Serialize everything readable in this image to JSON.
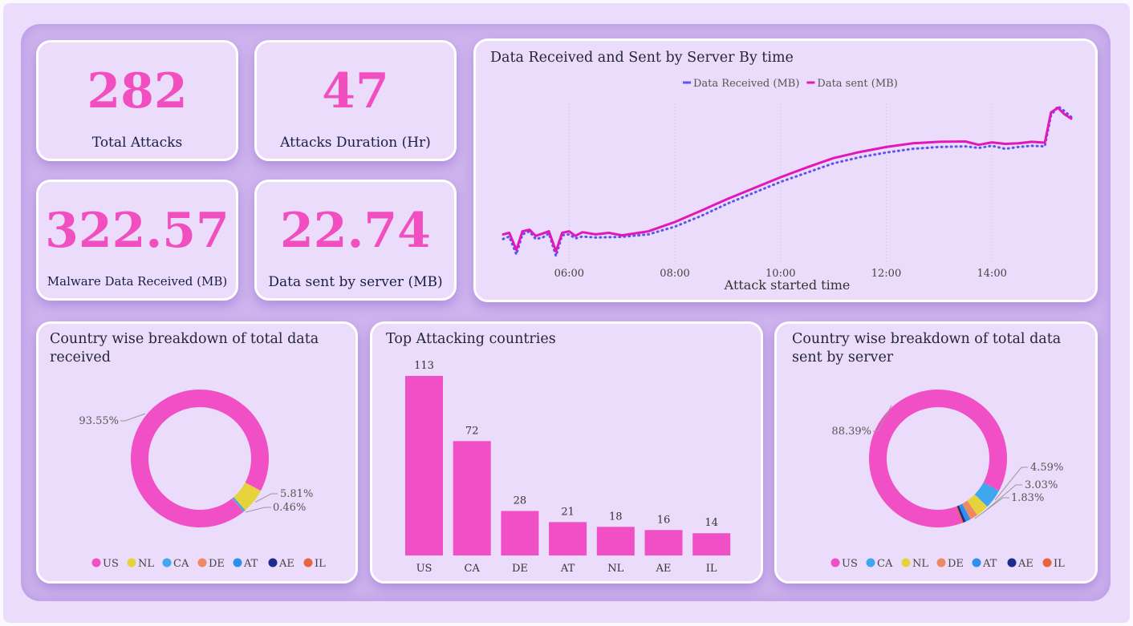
{
  "kpis": {
    "total_attacks": {
      "value": "282",
      "label": "Total Attacks"
    },
    "attacks_duration": {
      "value": "47",
      "label": "Attacks Duration (Hr)"
    },
    "malware_received": {
      "value": "322.57",
      "label": "Malware Data Received (MB)"
    },
    "data_sent": {
      "value": "22.74",
      "label": "Data sent by server (MB)"
    }
  },
  "colors": {
    "pink": "#f14fbf",
    "received_line": "#5b54f0",
    "sent_line": "#e317b9",
    "US": "#f14fc6",
    "NL": "#e6d23a",
    "CA": "#3fa7ef",
    "DE": "#ee8a63",
    "AT": "#2f8ff0",
    "AE": "#1d2b8f",
    "IL": "#e9643a"
  },
  "line_chart": {
    "title": "Data Received and Sent by Server By time",
    "xlabel": "Attack started time"
  },
  "bar_chart": {
    "title": "Top Attacking countries"
  },
  "donut_received": {
    "title": "Country wise breakdown of total data received"
  },
  "donut_sent": {
    "title": "Country wise breakdown of total data sent by server"
  },
  "chart_data": [
    {
      "type": "line",
      "title": "Data Received and Sent by Server By time",
      "xlabel": "Attack started time",
      "ylabel": "",
      "x_ticks": [
        "06:00",
        "08:00",
        "10:00",
        "12:00",
        "14:00"
      ],
      "xlim": [
        "04:45",
        "15:30"
      ],
      "legend_position": "top-center",
      "grid": "vertical dotted",
      "series": [
        {
          "name": "Data Received (MB)",
          "color": "#5b54f0",
          "style": "dotted",
          "x": [
            "04:45",
            "04:52",
            "05:00",
            "05:07",
            "05:15",
            "05:22",
            "05:30",
            "05:37",
            "05:45",
            "05:52",
            "06:00",
            "06:07",
            "06:15",
            "06:30",
            "06:45",
            "07:00",
            "07:30",
            "08:00",
            "08:30",
            "09:00",
            "09:30",
            "10:00",
            "10:30",
            "11:00",
            "11:30",
            "12:00",
            "12:30",
            "13:00",
            "13:30",
            "13:45",
            "14:00",
            "14:15",
            "14:30",
            "14:45",
            "15:00",
            "15:07",
            "15:15",
            "15:22",
            "15:30"
          ],
          "y": [
            0.8,
            0.88,
            0.3,
            0.95,
            1.05,
            0.8,
            0.85,
            0.98,
            0.25,
            0.92,
            0.95,
            0.82,
            0.88,
            0.85,
            0.86,
            0.87,
            0.95,
            1.2,
            1.55,
            1.95,
            2.3,
            2.65,
            2.95,
            3.25,
            3.45,
            3.6,
            3.72,
            3.78,
            3.8,
            3.75,
            3.82,
            3.72,
            3.78,
            3.82,
            3.8,
            4.8,
            5.1,
            4.95,
            4.75
          ]
        },
        {
          "name": "Data sent (MB)",
          "color": "#e317b9",
          "style": "solid",
          "x": [
            "04:45",
            "04:52",
            "05:00",
            "05:07",
            "05:15",
            "05:22",
            "05:30",
            "05:37",
            "05:45",
            "05:52",
            "06:00",
            "06:07",
            "06:15",
            "06:30",
            "06:45",
            "07:00",
            "07:30",
            "08:00",
            "08:30",
            "09:00",
            "09:30",
            "10:00",
            "10:30",
            "11:00",
            "11:30",
            "12:00",
            "12:30",
            "13:00",
            "13:30",
            "13:45",
            "14:00",
            "14:15",
            "14:30",
            "14:45",
            "15:00",
            "15:07",
            "15:15",
            "15:22",
            "15:30"
          ],
          "y": [
            0.95,
            1.0,
            0.45,
            1.05,
            1.1,
            0.9,
            0.98,
            1.05,
            0.4,
            1.0,
            1.05,
            0.9,
            1.02,
            0.95,
            1.0,
            0.92,
            1.05,
            1.35,
            1.72,
            2.1,
            2.45,
            2.8,
            3.12,
            3.42,
            3.62,
            3.78,
            3.9,
            3.95,
            3.96,
            3.85,
            3.93,
            3.88,
            3.9,
            3.95,
            3.92,
            4.9,
            5.05,
            4.85,
            4.7
          ]
        }
      ]
    },
    {
      "type": "bar",
      "title": "Top Attacking countries",
      "categories": [
        "US",
        "CA",
        "DE",
        "AT",
        "NL",
        "AE",
        "IL"
      ],
      "values": [
        113,
        72,
        28,
        21,
        18,
        16,
        14
      ],
      "ylim": [
        0,
        120
      ],
      "color": "#f14fc6"
    },
    {
      "type": "pie",
      "subtype": "donut",
      "title": "Country wise breakdown of total data received",
      "categories": [
        "US",
        "NL",
        "CA",
        "DE",
        "AT",
        "AE",
        "IL"
      ],
      "values": [
        93.55,
        5.81,
        0.46,
        0.08,
        0.05,
        0.03,
        0.02
      ],
      "shown_labels": [
        "93.55%",
        "5.81%",
        "0.46%"
      ],
      "legend_position": "bottom"
    },
    {
      "type": "pie",
      "subtype": "donut",
      "title": "Country wise breakdown of total data sent by server",
      "categories": [
        "US",
        "CA",
        "NL",
        "DE",
        "AT",
        "AE",
        "IL"
      ],
      "values": [
        88.39,
        4.59,
        3.03,
        1.83,
        1.2,
        0.6,
        0.36
      ],
      "shown_labels": [
        "88.39%",
        "4.59%",
        "3.03%",
        "1.83%"
      ],
      "legend_position": "bottom"
    }
  ]
}
